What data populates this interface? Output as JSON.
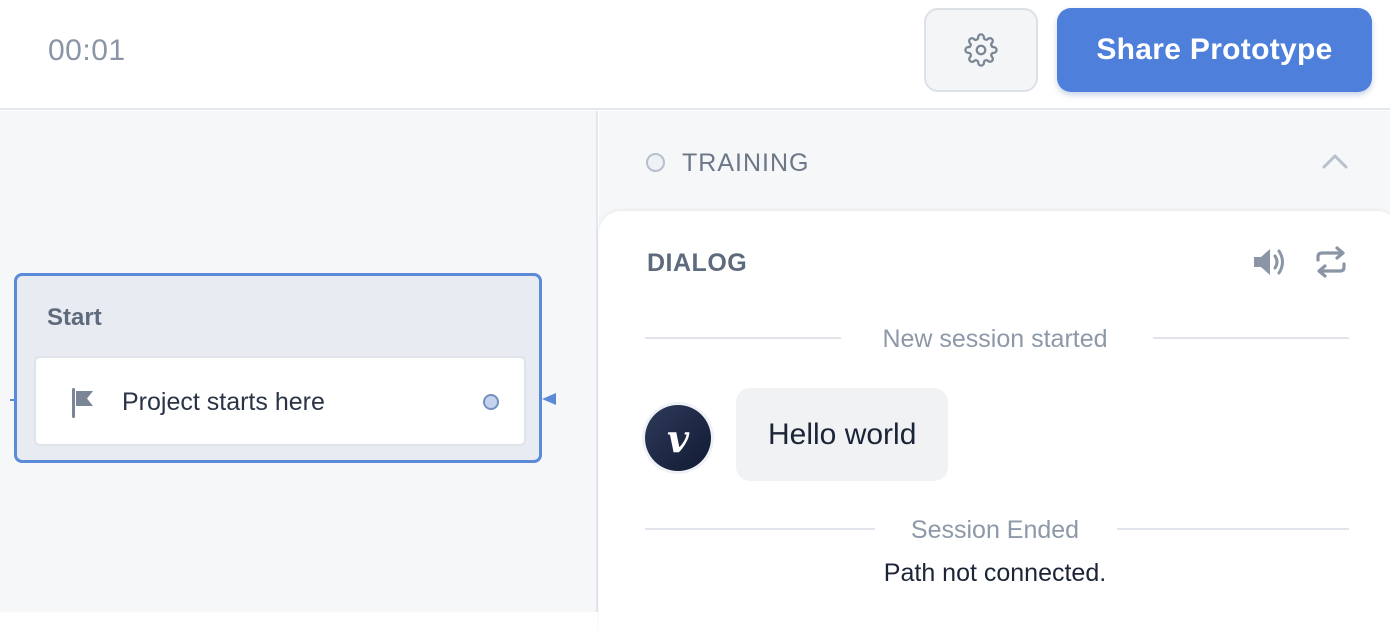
{
  "header": {
    "timer": "00:01",
    "settings_icon": "gear-icon",
    "share_label": "Share Prototype",
    "accent_color": "#4d7fdb"
  },
  "canvas": {
    "block": {
      "title": "Start",
      "step_label": "Project starts here",
      "step_icon": "flag-icon"
    }
  },
  "panel": {
    "training": {
      "label": "TRAINING",
      "toggle_icon": "chevron-up-icon"
    },
    "dialog": {
      "title": "DIALOG",
      "speaker_icon": "speaker-icon",
      "reset_icon": "reset-icon",
      "session_started": "New session started",
      "message": "Hello world",
      "avatar_letter": "v",
      "session_ended": "Session Ended",
      "path_status": "Path not connected."
    }
  }
}
